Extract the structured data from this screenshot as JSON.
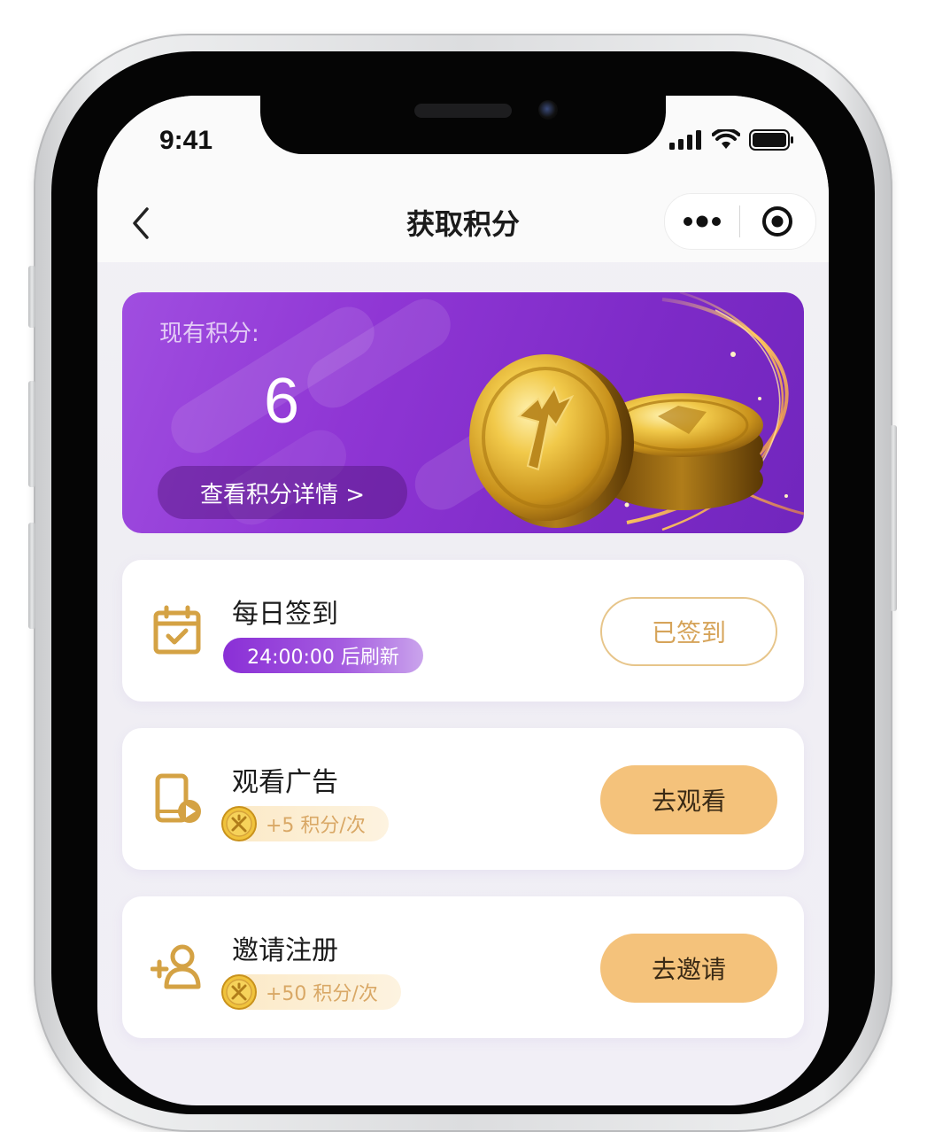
{
  "status_bar": {
    "time": "9:41"
  },
  "nav": {
    "title": "获取积分"
  },
  "balance": {
    "label": "现有积分:",
    "value": "6",
    "detail_button": "查看积分详情 >"
  },
  "tasks": [
    {
      "title": "每日签到",
      "badge": "24:00:00 后刷新",
      "button": "已签到",
      "icon": "calendar-check-icon"
    },
    {
      "title": "观看广告",
      "reward": "+5 积分/次",
      "button": "去观看",
      "icon": "phone-video-icon"
    },
    {
      "title": "邀请注册",
      "reward": "+50 积分/次",
      "button": "去邀请",
      "icon": "add-user-icon"
    }
  ],
  "colors": {
    "banner_purple": "#8f36d4",
    "gold": "#d9a866",
    "button_fill": "#f4c27b",
    "badge_purple": "#8a2fd6"
  }
}
